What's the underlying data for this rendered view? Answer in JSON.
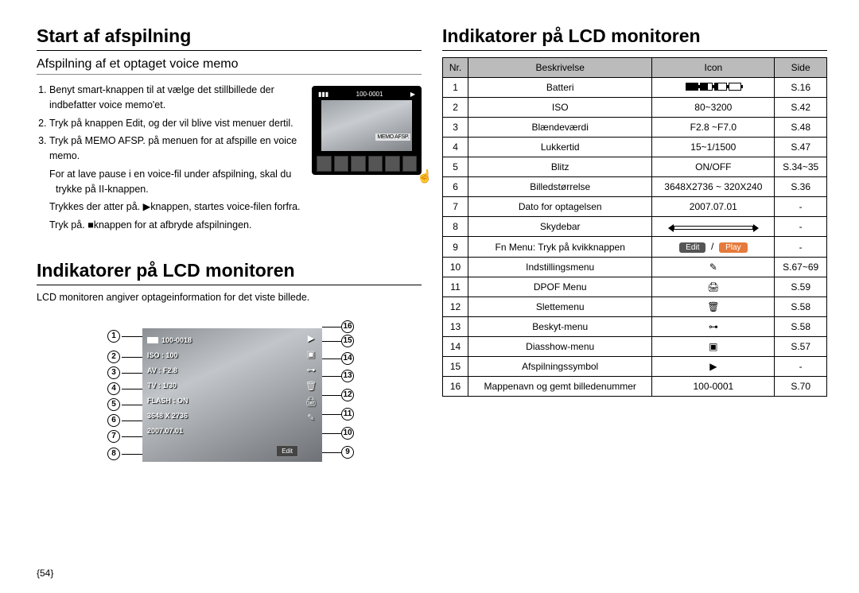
{
  "left": {
    "h1a": "Start af afspilning",
    "subhead": "Afspilning af et optaget voice memo",
    "steps": [
      "Benyt smart-knappen til at vælge det stillbillede der indbefatter voice memo'et.",
      "Tryk på knappen Edit, og der vil blive vist menuer dertil.",
      "Tryk på MEMO AFSP. på menuen for at afspille en voice memo."
    ],
    "substeps": [
      "For at lave pause i en voice-fil under afspilning, skal du trykke på II-knappen.",
      "Trykkes der atter på. ▶knappen, startes voice-filen forfra.",
      "Tryk på. ■knappen for at afbryde afspilningen."
    ],
    "mini": {
      "filenum": "100-0001",
      "memo": "MEMO AFSP."
    },
    "h1b": "Indikatorer på LCD monitoren",
    "desc": "LCD monitoren angiver optageinformation for det viste billede.",
    "lcd": {
      "filenum": "100-0018",
      "iso": "ISO : 100",
      "av": "AV : F2.8",
      "tv": "TV : 1/30",
      "flash": "FLASH : ON",
      "size": "3648 X 2736",
      "date": "2007.07.01",
      "edit": "Edit"
    }
  },
  "right": {
    "h1": "Indikatorer på LCD monitoren",
    "headers": {
      "nr": "Nr.",
      "beskrivelse": "Beskrivelse",
      "icon": "Icon",
      "side": "Side"
    },
    "rows": [
      {
        "nr": "1",
        "b": "Batteri",
        "icon": "battery",
        "side": "S.16"
      },
      {
        "nr": "2",
        "b": "ISO",
        "icon": "80~3200",
        "side": "S.42"
      },
      {
        "nr": "3",
        "b": "Blændeværdi",
        "icon": "F2.8 ~F7.0",
        "side": "S.48"
      },
      {
        "nr": "4",
        "b": "Lukkertid",
        "icon": "15~1/1500",
        "side": "S.47"
      },
      {
        "nr": "5",
        "b": "Blitz",
        "icon": "ON/OFF",
        "side": "S.34~35"
      },
      {
        "nr": "6",
        "b": "Billedstørrelse",
        "icon": "3648X2736 ~ 320X240",
        "side": "S.36"
      },
      {
        "nr": "7",
        "b": "Dato for optagelsen",
        "icon": "2007.07.01",
        "side": "-"
      },
      {
        "nr": "8",
        "b": "Skydebar",
        "icon": "slider",
        "side": "-"
      },
      {
        "nr": "9",
        "b": "Fn Menu: Tryk på kvikknappen",
        "icon": "editplay",
        "side": "-"
      },
      {
        "nr": "10",
        "b": "Indstillingsmenu",
        "icon": "✎",
        "side": "S.67~69"
      },
      {
        "nr": "11",
        "b": "DPOF Menu",
        "icon": "🖨",
        "side": "S.59"
      },
      {
        "nr": "12",
        "b": "Slettemenu",
        "icon": "🗑",
        "side": "S.58"
      },
      {
        "nr": "13",
        "b": "Beskyt-menu",
        "icon": "⊶",
        "side": "S.58"
      },
      {
        "nr": "14",
        "b": "Diasshow-menu",
        "icon": "▣",
        "side": "S.57"
      },
      {
        "nr": "15",
        "b": "Afspilningssymbol",
        "icon": "▶",
        "side": "-"
      },
      {
        "nr": "16",
        "b": "Mappenavn og gemt billedenummer",
        "icon": "100-0001",
        "side": "S.70"
      }
    ],
    "editLabel": "Edit",
    "playLabel": "Play"
  },
  "pageNum": "{54}"
}
